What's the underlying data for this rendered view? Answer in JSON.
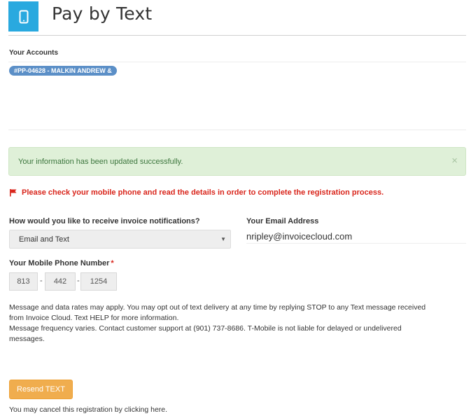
{
  "header": {
    "title": "Pay by Text",
    "icon": "mobile-phone-icon",
    "icon_color": "#29a9df"
  },
  "accounts": {
    "label": "Your Accounts",
    "items": [
      "#PP-04628 - MALKIN ANDREW &"
    ],
    "pill_color": "#5b8fc7"
  },
  "alert": {
    "message": "Your information has been updated successfully.",
    "close_symbol": "×"
  },
  "warning": {
    "icon": "flag-icon",
    "message": "Please check your mobile phone and read the details in order to complete the registration process."
  },
  "form": {
    "notification_label": "How would you like to receive invoice notifications?",
    "notification_value": "Email and Text",
    "email_label": "Your Email Address",
    "email_value": "nripley@invoicecloud.com",
    "phone_label": "Your Mobile Phone Number",
    "phone_required": "*",
    "phone_area": "813",
    "phone_prefix": "442",
    "phone_line": "1254",
    "phone_separator": "-"
  },
  "disclaimer": {
    "line1": "Message and data rates may apply. You may opt out of text delivery at any time by replying STOP to any Text message received",
    "line2": "from Invoice Cloud. Text HELP for more information.",
    "line3": "Message frequency varies. Contact customer support at (901) 737-8686. T-Mobile is not liable for delayed or undelivered",
    "line4": "messages."
  },
  "actions": {
    "resend_label": "Resend TEXT",
    "button_color": "#f0ad4e",
    "cancel_prefix": "You may cancel this registration by clicking ",
    "cancel_link": "here",
    "cancel_suffix": "."
  }
}
